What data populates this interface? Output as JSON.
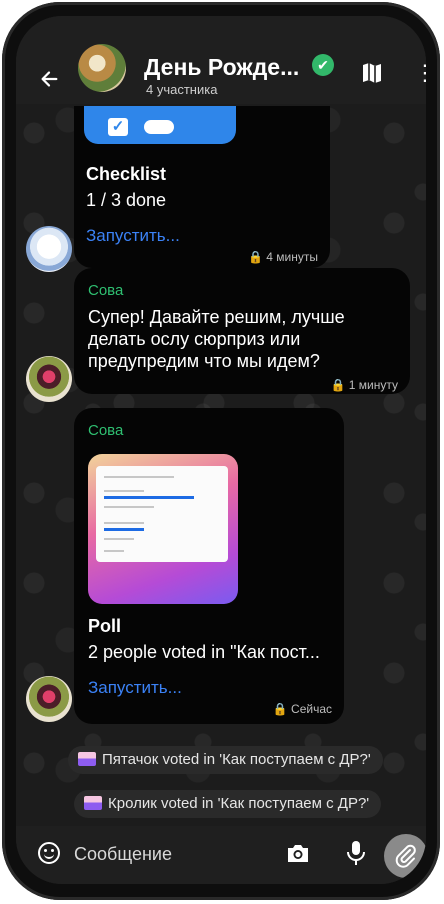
{
  "header": {
    "title": "День Рожде...",
    "members": "4 участника"
  },
  "messages": {
    "checklist": {
      "title": "Checklist",
      "progress": "1 / 3 done",
      "action": "Запустить...",
      "time": "4 минуты"
    },
    "text_msg": {
      "sender": "Сова",
      "text": "Супер! Давайте решим, лучше делать ослу сюрприз или предупредим что мы идем?",
      "time": "1 минуту"
    },
    "poll": {
      "sender": "Сова",
      "title": "Poll",
      "summary": "2 people voted in \"Как пост...",
      "action": "Запустить...",
      "time": "Сейчас"
    }
  },
  "notices": [
    "Пятачок voted in 'Как поступаем с ДР?'",
    "Кролик voted in 'Как поступаем с ДР?'"
  ],
  "input": {
    "placeholder": "Сообщение"
  },
  "colors": {
    "sender": "#2fbf71",
    "link": "#3b82f6",
    "verified": "#32b86a",
    "checklist_card": "#2f86ea"
  },
  "icons": {
    "back": "arrow-left-icon",
    "verified": "verified-check-icon",
    "map": "map-icon",
    "more": "more-vertical-icon",
    "emoji": "emoji-icon",
    "camera": "camera-icon",
    "mic": "microphone-icon",
    "attach": "paperclip-icon"
  }
}
